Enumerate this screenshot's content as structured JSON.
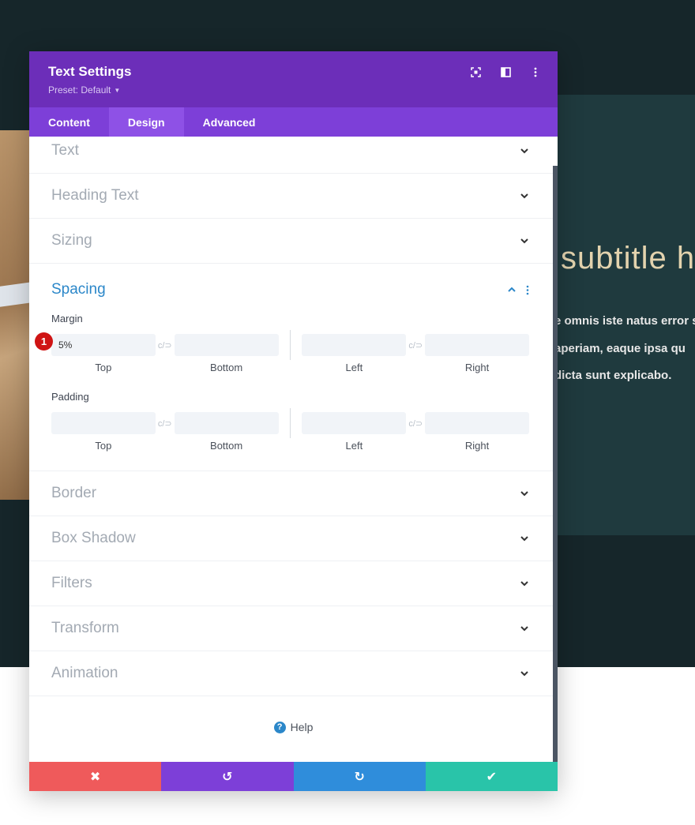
{
  "background": {
    "subtitle": "subtitle h",
    "lines": [
      "e omnis iste natus error si",
      "aperiam, eaque ipsa qu",
      "dicta sunt explicabo."
    ]
  },
  "modal": {
    "title": "Text Settings",
    "preset": "Preset: Default",
    "tabs": [
      {
        "label": "Content",
        "active": false
      },
      {
        "label": "Design",
        "active": true
      },
      {
        "label": "Advanced",
        "active": false
      }
    ],
    "sections_top": [
      "Text",
      "Heading Text",
      "Sizing"
    ],
    "spacing": {
      "title": "Spacing",
      "margin": {
        "label": "Margin",
        "values": {
          "top": "5%",
          "bottom": "",
          "left": "",
          "right": ""
        },
        "badge": "1"
      },
      "padding": {
        "label": "Padding",
        "values": {
          "top": "",
          "bottom": "",
          "left": "",
          "right": ""
        }
      },
      "side_labels": {
        "top": "Top",
        "bottom": "Bottom",
        "left": "Left",
        "right": "Right"
      },
      "link_glyph": "c/⊃"
    },
    "sections_bottom": [
      "Border",
      "Box Shadow",
      "Filters",
      "Transform",
      "Animation"
    ],
    "help": {
      "icon": "?",
      "label": "Help"
    },
    "footer": {
      "cancel": "✖",
      "undo": "↺",
      "redo": "↻",
      "save": "✔"
    },
    "colors": {
      "header": "#6c2eb9",
      "tabs": "#7d3fd8",
      "accent": "#2b87c9",
      "cancel": "#ef5a5b",
      "redo": "#2f8ddb",
      "save": "#29c4a9"
    }
  }
}
